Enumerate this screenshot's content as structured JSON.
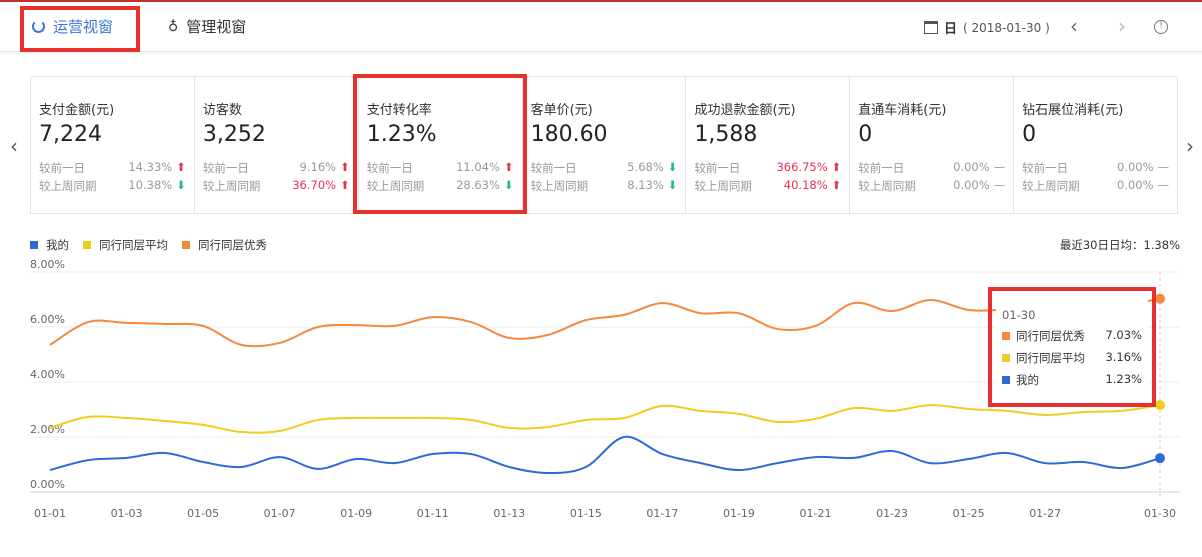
{
  "tabs": [
    {
      "label": "运营视窗",
      "icon": "refresh-circle-icon",
      "active": true
    },
    {
      "label": "管理视窗",
      "icon": "person-icon",
      "active": false
    }
  ],
  "date": {
    "unit": "日",
    "value": "( 2018-01-30 )"
  },
  "cards": [
    {
      "title": "支付金额(元)",
      "value": "7,224",
      "rows": [
        {
          "label": "较前一日",
          "pct": "14.33%",
          "dir": "up"
        },
        {
          "label": "较上周同期",
          "pct": "10.38%",
          "dir": "down"
        }
      ]
    },
    {
      "title": "访客数",
      "value": "3,252",
      "rows": [
        {
          "label": "较前一日",
          "pct": "9.16%",
          "dir": "up"
        },
        {
          "label": "较上周同期",
          "pct": "36.70%",
          "dir": "up",
          "red": true
        }
      ]
    },
    {
      "title": "支付转化率",
      "value": "1.23%",
      "rows": [
        {
          "label": "较前一日",
          "pct": "11.04%",
          "dir": "up"
        },
        {
          "label": "较上周同期",
          "pct": "28.63%",
          "dir": "down"
        }
      ]
    },
    {
      "title": "客单价(元)",
      "value": "180.60",
      "rows": [
        {
          "label": "较前一日",
          "pct": "5.68%",
          "dir": "down"
        },
        {
          "label": "较上周同期",
          "pct": "8.13%",
          "dir": "down"
        }
      ]
    },
    {
      "title": "成功退款金额(元)",
      "value": "1,588",
      "rows": [
        {
          "label": "较前一日",
          "pct": "366.75%",
          "dir": "up",
          "red": true
        },
        {
          "label": "较上周同期",
          "pct": "40.18%",
          "dir": "up",
          "red": true
        }
      ]
    },
    {
      "title": "直通车消耗(元)",
      "value": "0",
      "rows": [
        {
          "label": "较前一日",
          "pct": "0.00%",
          "dir": "flat"
        },
        {
          "label": "较上周同期",
          "pct": "0.00%",
          "dir": "flat"
        }
      ]
    },
    {
      "title": "钻石展位消耗(元)",
      "value": "0",
      "rows": [
        {
          "label": "较前一日",
          "pct": "0.00%",
          "dir": "flat"
        },
        {
          "label": "较上周同期",
          "pct": "0.00%",
          "dir": "flat"
        }
      ]
    }
  ],
  "avg_label": "最近30日日均：1.38%",
  "tooltip": {
    "date": "01-30",
    "rows": [
      {
        "name": "同行同层优秀",
        "value": "7.03%",
        "color": "#f5883a"
      },
      {
        "name": "同行同层平均",
        "value": "3.16%",
        "color": "#f0cc1c"
      },
      {
        "name": "我的",
        "value": "1.23%",
        "color": "#2d6ad8"
      }
    ]
  },
  "chart_data": {
    "type": "line",
    "ylim": [
      0,
      8
    ],
    "yticks": [
      "0.00%",
      "2.00%",
      "4.00%",
      "6.00%",
      "8.00%"
    ],
    "xticks": [
      "01-01",
      "01-03",
      "01-05",
      "01-07",
      "01-09",
      "01-11",
      "01-13",
      "01-15",
      "01-17",
      "01-19",
      "01-21",
      "01-23",
      "01-25",
      "01-27",
      "01-30"
    ],
    "series": [
      {
        "name": "我的",
        "color": "#2d6ad8",
        "values": [
          0.8,
          1.16,
          1.24,
          1.42,
          1.09,
          0.91,
          1.27,
          0.84,
          1.2,
          1.05,
          1.38,
          1.38,
          0.91,
          0.69,
          0.91,
          2.0,
          1.38,
          1.05,
          0.8,
          1.05,
          1.27,
          1.24,
          1.49,
          1.05,
          1.2,
          1.42,
          1.05,
          1.09,
          0.87,
          1.23
        ]
      },
      {
        "name": "同行同层平均",
        "color": "#f0cc1c",
        "values": [
          2.33,
          2.73,
          2.69,
          2.58,
          2.44,
          2.18,
          2.22,
          2.62,
          2.69,
          2.69,
          2.69,
          2.62,
          2.33,
          2.36,
          2.62,
          2.69,
          3.13,
          2.95,
          2.84,
          2.55,
          2.66,
          3.05,
          2.95,
          3.16,
          3.02,
          2.95,
          2.8,
          2.91,
          2.95,
          3.16
        ]
      },
      {
        "name": "同行同层优秀",
        "color": "#f5883a",
        "values": [
          5.35,
          6.18,
          6.15,
          6.11,
          6.04,
          5.35,
          5.42,
          6.0,
          6.07,
          6.04,
          6.36,
          6.18,
          5.6,
          5.71,
          6.25,
          6.44,
          6.87,
          6.5,
          6.5,
          5.93,
          6.04,
          6.87,
          6.58,
          6.98,
          6.62,
          6.65,
          6.85,
          6.9,
          6.8,
          7.03
        ]
      }
    ]
  }
}
